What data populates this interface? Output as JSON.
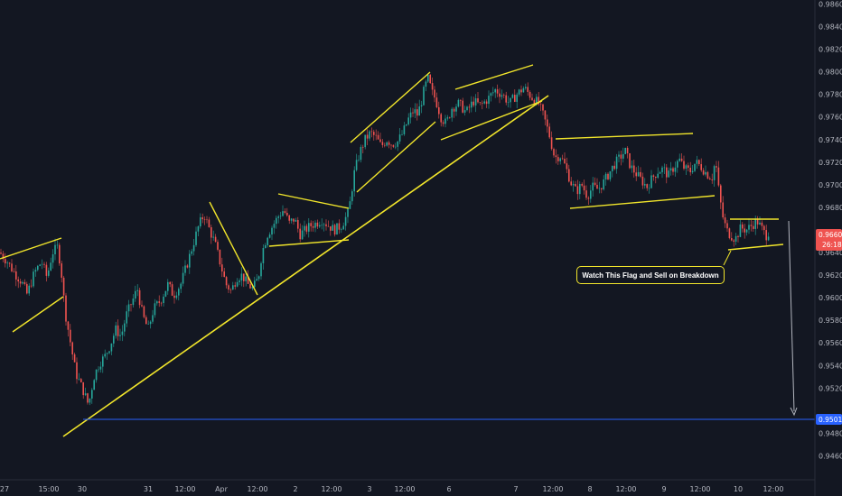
{
  "colors": {
    "background": "#131722",
    "up_candle": "#26a69a",
    "down_candle": "#ef5350",
    "trendline": "#f2e62b",
    "target_line": "#2962ff",
    "axis_text": "#b2b5be",
    "current_price_badge": "#ef5350",
    "target_price_badge": "#2962ff"
  },
  "annotation": {
    "text": "Watch This Flag and  Sell  on Breakdown"
  },
  "chart_data": {
    "type": "candlestick",
    "title": "",
    "grid": false,
    "y_axis_position": "right",
    "ylim": [
      0.945,
      0.9862
    ],
    "y_ticks": [
      "0.98600",
      "0.98400",
      "0.98200",
      "0.98000",
      "0.97800",
      "0.97600",
      "0.97400",
      "0.97200",
      "0.97000",
      "0.96800",
      "0.96400",
      "0.96200",
      "0.96000",
      "0.95800",
      "0.95600",
      "0.95400",
      "0.95200",
      "0.94800",
      "0.94600"
    ],
    "x_ticks": [
      "27",
      "15:00",
      "30",
      "31",
      "12:00",
      "Apr",
      "12:00",
      "2",
      "12:00",
      "3",
      "12:00",
      "6",
      "7",
      "12:00",
      "8",
      "12:00",
      "9",
      "12:00",
      "10",
      "12:00"
    ],
    "current_price": {
      "value": "0.96601",
      "countdown": "26:18"
    },
    "target_price": {
      "value": "0.95018"
    },
    "price_path": [
      [
        0,
        0.964
      ],
      [
        8,
        0.9632
      ],
      [
        16,
        0.9622
      ],
      [
        24,
        0.9614
      ],
      [
        30,
        0.9603
      ],
      [
        38,
        0.9622
      ],
      [
        46,
        0.9632
      ],
      [
        52,
        0.9618
      ],
      [
        58,
        0.964
      ],
      [
        64,
        0.9645
      ],
      [
        68,
        0.9622
      ],
      [
        72,
        0.9588
      ],
      [
        78,
        0.956
      ],
      [
        84,
        0.9533
      ],
      [
        92,
        0.9518
      ],
      [
        98,
        0.9505
      ],
      [
        104,
        0.953
      ],
      [
        110,
        0.9542
      ],
      [
        116,
        0.9548
      ],
      [
        122,
        0.9558
      ],
      [
        128,
        0.9572
      ],
      [
        134,
        0.9566
      ],
      [
        140,
        0.9585
      ],
      [
        146,
        0.9596
      ],
      [
        152,
        0.9608
      ],
      [
        158,
        0.9584
      ],
      [
        164,
        0.9572
      ],
      [
        170,
        0.959
      ],
      [
        178,
        0.9598
      ],
      [
        186,
        0.9612
      ],
      [
        192,
        0.9602
      ],
      [
        200,
        0.9612
      ],
      [
        208,
        0.9632
      ],
      [
        214,
        0.9648
      ],
      [
        220,
        0.9664
      ],
      [
        226,
        0.9674
      ],
      [
        232,
        0.966
      ],
      [
        238,
        0.9648
      ],
      [
        244,
        0.963
      ],
      [
        250,
        0.9612
      ],
      [
        256,
        0.9606
      ],
      [
        262,
        0.9618
      ],
      [
        268,
        0.962
      ],
      [
        274,
        0.9612
      ],
      [
        280,
        0.9608
      ],
      [
        286,
        0.9618
      ],
      [
        290,
        0.964
      ],
      [
        296,
        0.9656
      ],
      [
        302,
        0.9664
      ],
      [
        308,
        0.9672
      ],
      [
        314,
        0.9678
      ],
      [
        320,
        0.9666
      ],
      [
        326,
        0.967
      ],
      [
        332,
        0.9656
      ],
      [
        338,
        0.966
      ],
      [
        344,
        0.9664
      ],
      [
        350,
        0.9666
      ],
      [
        356,
        0.9669
      ],
      [
        362,
        0.9665
      ],
      [
        370,
        0.966
      ],
      [
        378,
        0.9664
      ],
      [
        386,
        0.9676
      ],
      [
        392,
        0.971
      ],
      [
        398,
        0.9728
      ],
      [
        404,
        0.974
      ],
      [
        410,
        0.9746
      ],
      [
        416,
        0.9742
      ],
      [
        422,
        0.9734
      ],
      [
        428,
        0.974
      ],
      [
        434,
        0.9736
      ],
      [
        440,
        0.9738
      ],
      [
        446,
        0.9746
      ],
      [
        452,
        0.9758
      ],
      [
        458,
        0.9766
      ],
      [
        462,
        0.9762
      ],
      [
        466,
        0.9772
      ],
      [
        470,
        0.9786
      ],
      [
        474,
        0.9794
      ],
      [
        478,
        0.9782
      ],
      [
        482,
        0.9776
      ],
      [
        488,
        0.976
      ],
      [
        494,
        0.9754
      ],
      [
        500,
        0.9768
      ],
      [
        508,
        0.9772
      ],
      [
        516,
        0.9764
      ],
      [
        524,
        0.9774
      ],
      [
        532,
        0.977
      ],
      [
        540,
        0.9776
      ],
      [
        548,
        0.9784
      ],
      [
        556,
        0.978
      ],
      [
        564,
        0.9772
      ],
      [
        572,
        0.978
      ],
      [
        580,
        0.9786
      ],
      [
        588,
        0.9778
      ],
      [
        596,
        0.9772
      ],
      [
        602,
        0.976
      ],
      [
        608,
        0.9744
      ],
      [
        614,
        0.9724
      ],
      [
        620,
        0.9726
      ],
      [
        626,
        0.9716
      ],
      [
        632,
        0.9702
      ],
      [
        638,
        0.9694
      ],
      [
        644,
        0.97
      ],
      [
        650,
        0.969
      ],
      [
        656,
        0.9698
      ],
      [
        662,
        0.9696
      ],
      [
        668,
        0.9702
      ],
      [
        674,
        0.971
      ],
      [
        680,
        0.9718
      ],
      [
        686,
        0.9724
      ],
      [
        692,
        0.973
      ],
      [
        698,
        0.9716
      ],
      [
        704,
        0.971
      ],
      [
        710,
        0.9704
      ],
      [
        716,
        0.9698
      ],
      [
        722,
        0.9706
      ],
      [
        728,
        0.9712
      ],
      [
        734,
        0.9714
      ],
      [
        740,
        0.9708
      ],
      [
        746,
        0.9716
      ],
      [
        752,
        0.9722
      ],
      [
        758,
        0.9714
      ],
      [
        764,
        0.9712
      ],
      [
        770,
        0.972
      ],
      [
        776,
        0.9716
      ],
      [
        782,
        0.971
      ],
      [
        788,
        0.9706
      ],
      [
        792,
        0.9722
      ],
      [
        796,
        0.9692
      ],
      [
        800,
        0.9672
      ],
      [
        804,
        0.966
      ],
      [
        808,
        0.9656
      ],
      [
        814,
        0.9652
      ],
      [
        820,
        0.9662
      ],
      [
        826,
        0.966
      ],
      [
        832,
        0.9664
      ],
      [
        838,
        0.9668
      ],
      [
        844,
        0.966
      ],
      [
        848,
        0.9655
      ],
      [
        852,
        0.966
      ]
    ]
  }
}
